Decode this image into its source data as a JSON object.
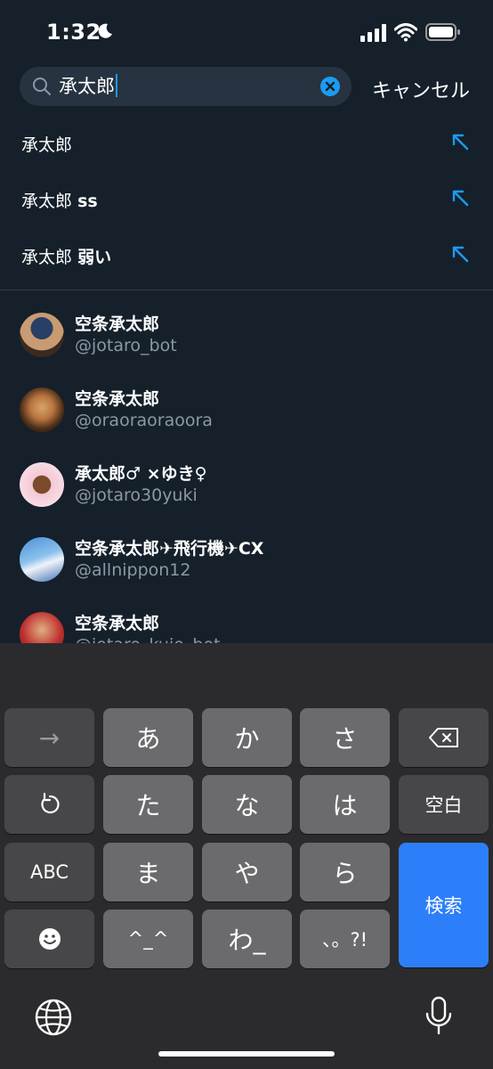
{
  "status": {
    "time": "1:32"
  },
  "search": {
    "query": "承太郎",
    "cancel": "キャンセル"
  },
  "suggestions": [
    {
      "base": "承太郎",
      "extra": ""
    },
    {
      "base": "承太郎",
      "extra": "ss"
    },
    {
      "base": "承太郎",
      "extra": "弱い"
    }
  ],
  "users": [
    {
      "name": "空条承太郎",
      "handle": "@jotaro_bot"
    },
    {
      "name": "空条承太郎",
      "handle": "@oraoraoraoora"
    },
    {
      "name": "承太郎♂ ×ゆき♀",
      "handle": "@jotaro30yuki"
    },
    {
      "name": "空条承太郎✈飛行機✈CX",
      "handle": "@allnippon12"
    },
    {
      "name": "空条承太郎",
      "handle": "@jotaro_kujo_bot"
    }
  ],
  "keyboard": {
    "row1": [
      "→",
      "あ",
      "か",
      "さ",
      "⌫"
    ],
    "row2": [
      "↺",
      "た",
      "な",
      "は",
      "空白"
    ],
    "row3": [
      "ABC",
      "ま",
      "や",
      "ら"
    ],
    "row4": [
      "☻",
      "^_^",
      "わ_",
      "、。?!"
    ],
    "search_key": "検索"
  },
  "colors": {
    "background": "#15202b",
    "accent": "#1d9bf0",
    "keyboard": "#2b2b2d"
  }
}
